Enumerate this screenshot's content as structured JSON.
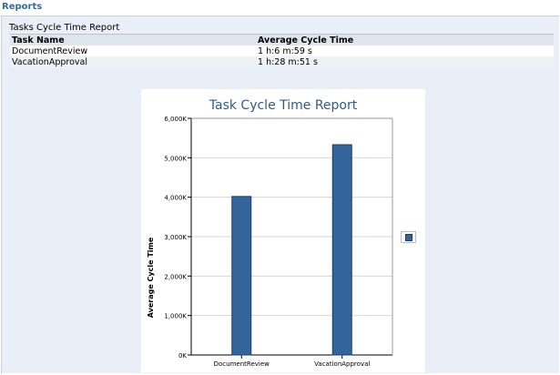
{
  "header": {
    "title": "Reports"
  },
  "panel": {
    "title": "Tasks Cycle Time Report"
  },
  "table": {
    "columns": [
      "Task Name",
      "Average Cycle Time"
    ],
    "rows": [
      [
        "DocumentReview",
        "1 h:6 m:59 s"
      ],
      [
        "VacationApproval",
        "1 h:28 m:51 s"
      ]
    ]
  },
  "colors": {
    "bar": "#33659b",
    "bar_border": "#1f3f66",
    "title": "#2d5c8f",
    "link": "#2a6fa8"
  },
  "chart_data": {
    "type": "bar",
    "title": "Task Cycle Time Report",
    "xlabel": "",
    "ylabel": "Average Cycle Time",
    "categories": [
      "DocumentReview",
      "VacationApproval"
    ],
    "values": [
      4019000,
      5331000
    ],
    "ylim": [
      0,
      6000000
    ],
    "yticks": [
      0,
      1000000,
      2000000,
      3000000,
      4000000,
      5000000,
      6000000
    ],
    "ytick_labels": [
      "0K",
      "1,000K",
      "2,000K",
      "3,000K",
      "4,000K",
      "5,000K",
      "6,000K"
    ],
    "grid": true,
    "legend": "right"
  }
}
